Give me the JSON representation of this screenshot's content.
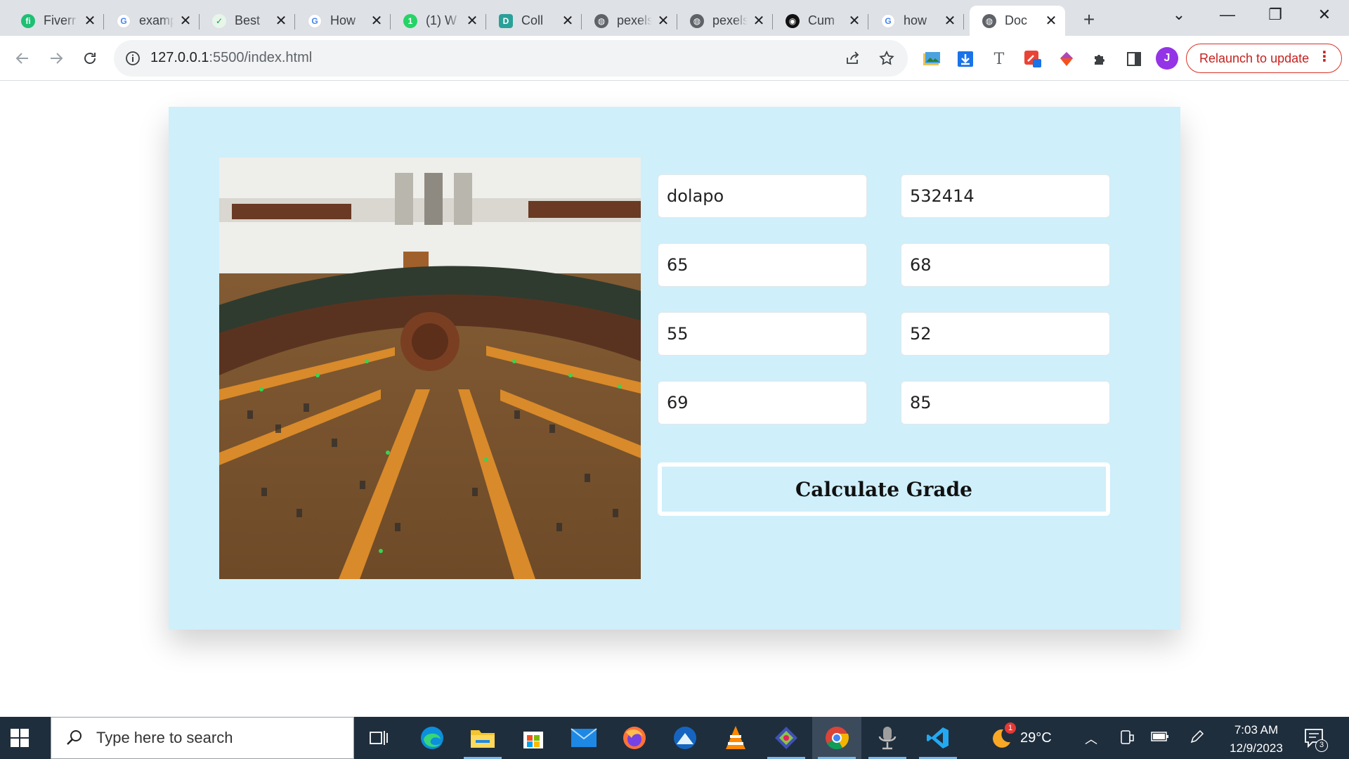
{
  "browser": {
    "tabs": [
      {
        "title": "Fiverr",
        "favicon": "fiverr-icon",
        "color": "#1dbf73",
        "glyph": "fi"
      },
      {
        "title": "example",
        "favicon": "google-icon",
        "color": "#4285f4",
        "glyph": "G"
      },
      {
        "title": "Best",
        "favicon": "shield-icon",
        "color": "#0f9d58",
        "glyph": "✓"
      },
      {
        "title": "How",
        "favicon": "google-icon",
        "color": "#4285f4",
        "glyph": "G"
      },
      {
        "title": "(1) W",
        "favicon": "whatsapp-icon",
        "color": "#25d366",
        "glyph": "1"
      },
      {
        "title": "Coll",
        "favicon": "collab-icon",
        "color": "#2aa198",
        "glyph": "D"
      },
      {
        "title": "pexels",
        "favicon": "globe-icon",
        "color": "#5f6368",
        "glyph": "◍"
      },
      {
        "title": "pexels",
        "favicon": "globe-icon",
        "color": "#5f6368",
        "glyph": "◍"
      },
      {
        "title": "Cum",
        "favicon": "github-icon",
        "color": "#111111",
        "glyph": "◉"
      },
      {
        "title": "how",
        "favicon": "google-icon",
        "color": "#4285f4",
        "glyph": "G"
      },
      {
        "title": "Doc",
        "favicon": "globe-icon",
        "color": "#5f6368",
        "glyph": "◍",
        "active": true
      }
    ],
    "address": {
      "host": "127.0.0.1",
      "path": ":5500/index.html"
    },
    "relaunch_label": "Relaunch to update",
    "profile_initial": "J"
  },
  "form": {
    "name": "dolapo",
    "matric": "532414",
    "scores": [
      "65",
      "68",
      "55",
      "52",
      "69",
      "85"
    ],
    "button_label": "Calculate Grade"
  },
  "colors": {
    "card_bg": "#cfeffa",
    "page_bg": "#ffffff",
    "taskbar_bg": "#1f2e3d",
    "relaunch_red": "#d93025"
  },
  "taskbar": {
    "search_placeholder": "Type here to search",
    "temperature": "29°C",
    "time": "7:03 AM",
    "date": "12/9/2023",
    "notification_count": "3",
    "weather_badge": "1"
  }
}
